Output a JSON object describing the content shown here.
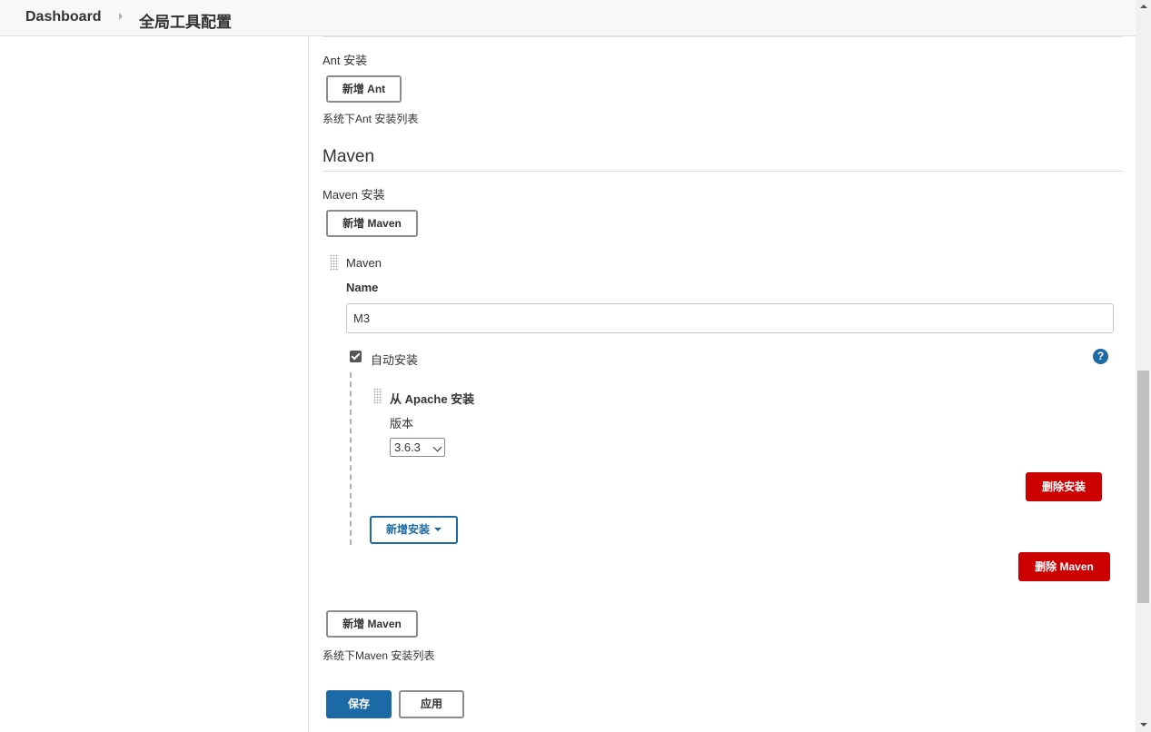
{
  "breadcrumb": {
    "home": "Dashboard",
    "current": "全局工具配置"
  },
  "ant": {
    "install_label": "Ant 安装",
    "add_button": "新增 Ant",
    "description": "系统下Ant 安装列表"
  },
  "maven": {
    "section_title": "Maven",
    "install_label": "Maven 安装",
    "add_button_top": "新增 Maven",
    "item": {
      "title": "Maven",
      "name_label": "Name",
      "name_value": "M3",
      "auto_install_label": "自动安装",
      "auto_install_checked": true,
      "installer": {
        "title": "从 Apache 安装",
        "version_label": "版本",
        "version_selected": "3.6.3",
        "delete_installer_button": "删除安装"
      },
      "add_installer_button": "新增安装",
      "delete_maven_button": "删除 Maven"
    },
    "add_button_bottom": "新增 Maven",
    "description": "系统下Maven 安装列表"
  },
  "footer": {
    "save_button": "保存",
    "apply_button": "应用"
  },
  "help_icon_glyph": "?",
  "colors": {
    "primary": "#1b6aa5",
    "danger": "#cc0000",
    "header_bg": "#f8f8f8"
  }
}
